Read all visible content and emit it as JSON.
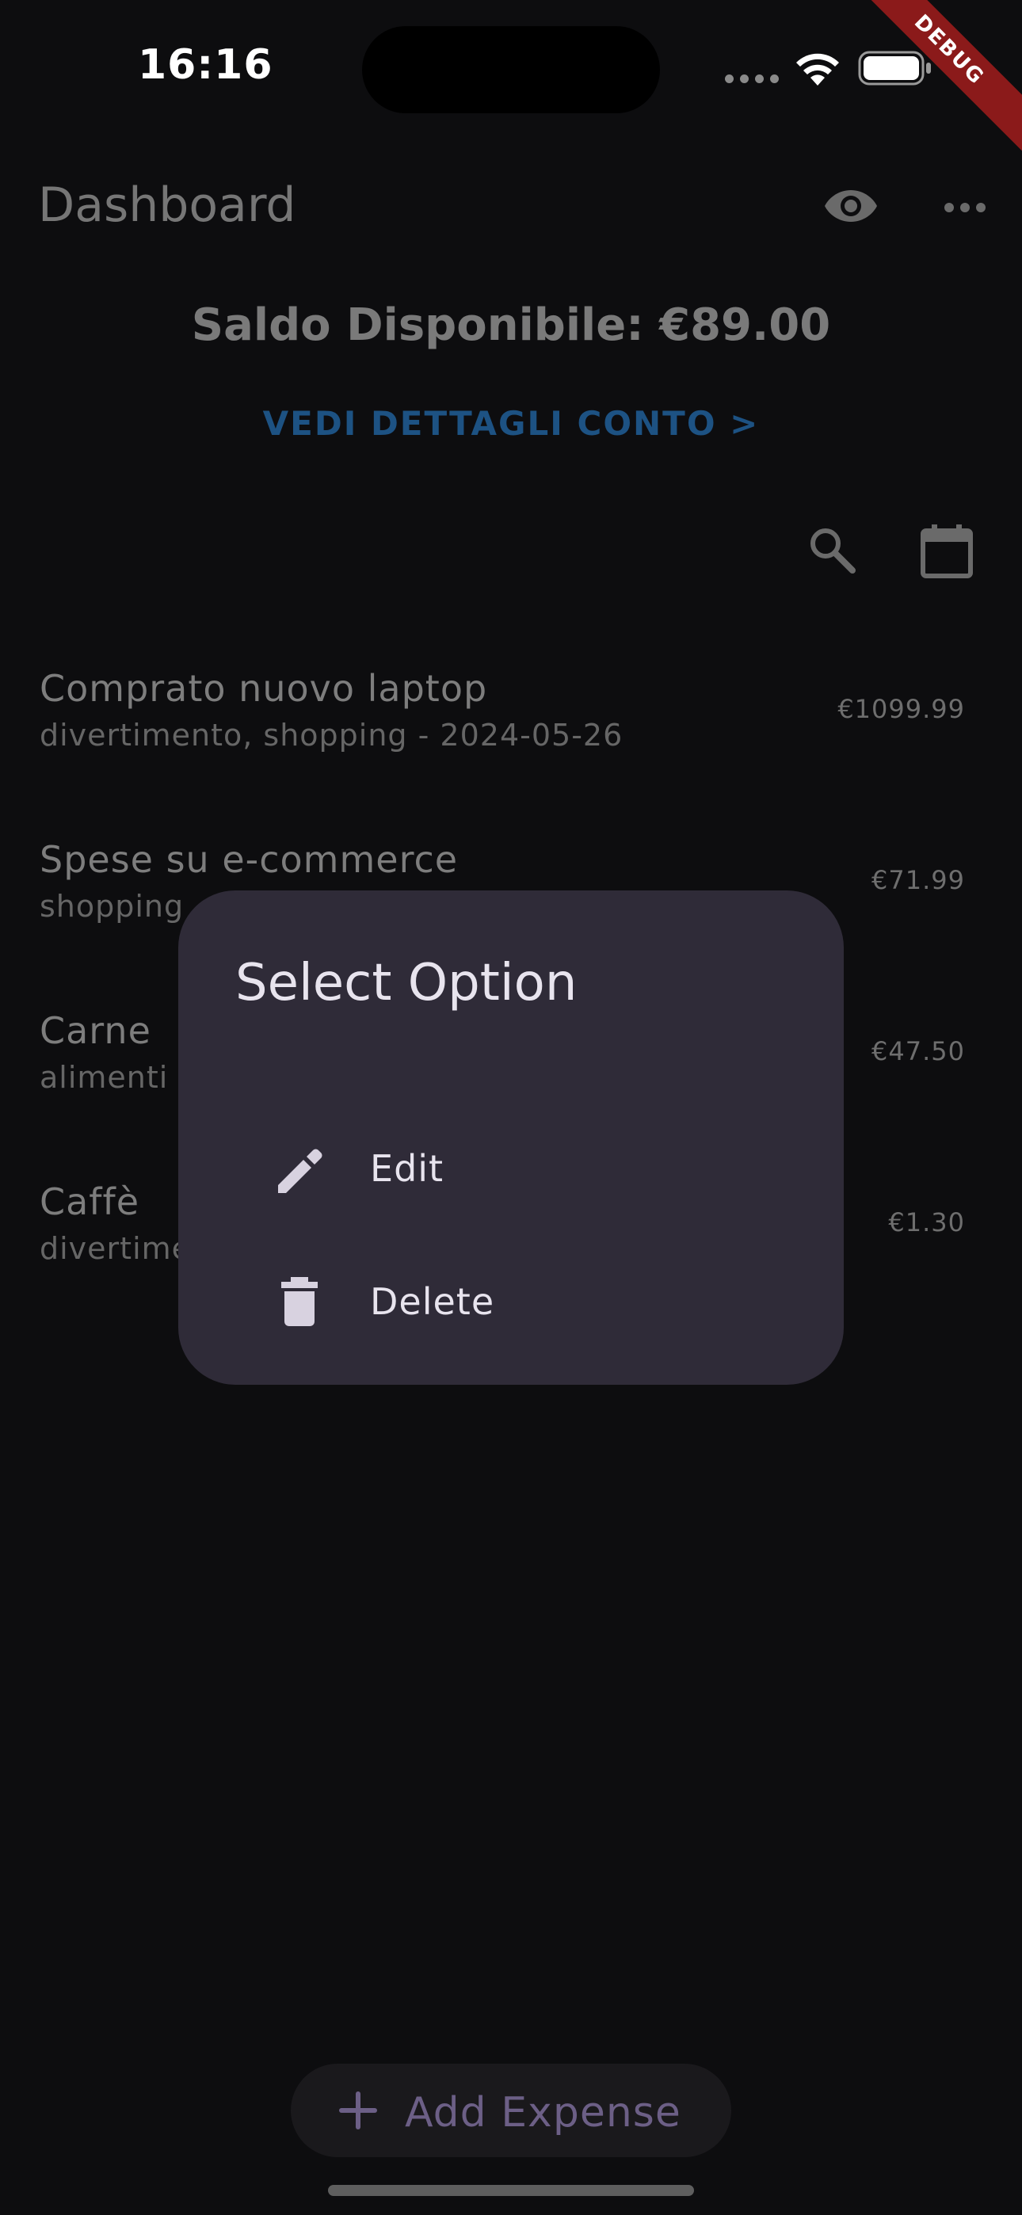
{
  "status_bar": {
    "time": "16:16"
  },
  "debug_banner": "DEBUG",
  "app_bar": {
    "title": "Dashboard",
    "visibility_icon": "eye-icon",
    "menu_icon": "more-horizontal-icon"
  },
  "balance": {
    "text": "Saldo Disponibile: €89.00"
  },
  "details_link": {
    "text": "VEDI DETTAGLI CONTO >"
  },
  "toolbar": {
    "search_icon": "search-icon",
    "calendar_icon": "calendar-icon"
  },
  "expenses": [
    {
      "title": "Comprato nuovo laptop",
      "subtitle": "divertimento, shopping - 2024-05-26",
      "amount": "€1099.99"
    },
    {
      "title": "Spese su e-commerce",
      "subtitle": "shopping",
      "amount": "€71.99"
    },
    {
      "title": "Carne",
      "subtitle": "alimenti",
      "amount": "€47.50"
    },
    {
      "title": "Caffè",
      "subtitle": "divertime",
      "amount": "€1.30"
    }
  ],
  "dialog": {
    "title": "Select Option",
    "options": [
      {
        "label": "Edit",
        "icon": "pencil-icon"
      },
      {
        "label": "Delete",
        "icon": "trash-icon"
      }
    ]
  },
  "add_button": {
    "label": "Add Expense",
    "icon": "plus-icon"
  },
  "colors": {
    "background": "#0d0d0f",
    "dialog_bg": "#2f2b38",
    "link": "#1d5283",
    "accent": "#6c5f86",
    "debug_ribbon": "#8b1a1a"
  }
}
